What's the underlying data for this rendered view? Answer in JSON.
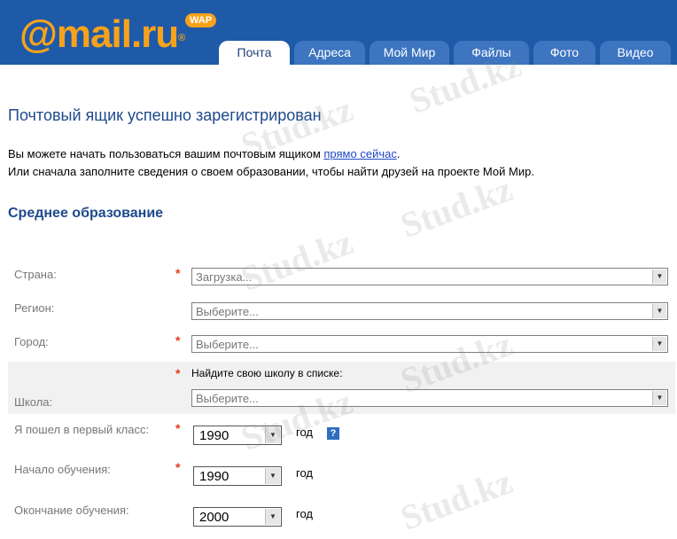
{
  "header": {
    "logo": "@mail.ru",
    "logo_mark": "®",
    "wap_badge": "WAP",
    "tabs": [
      {
        "label": "Почта"
      },
      {
        "label": "Адреса"
      },
      {
        "label": "Мой Мир"
      },
      {
        "label": "Файлы"
      },
      {
        "label": "Фото"
      },
      {
        "label": "Видео"
      }
    ]
  },
  "main": {
    "title": "Почтовый ящик успешно зарегистрирован",
    "intro_1_before": "Вы можете начать пользоваться вашим почтовым ящиком ",
    "intro_1_link": "прямо сейчас",
    "intro_1_after": ".",
    "intro_2": "Или сначала заполните сведения о своем образовании, чтобы найти друзей на проекте Мой Мир.",
    "section_title": "Среднее образование"
  },
  "form": {
    "required_mark": "*",
    "country": {
      "label": "Страна:",
      "value": "Загрузка..."
    },
    "region": {
      "label": "Регион:",
      "value": "Выберите..."
    },
    "city": {
      "label": "Город:",
      "value": "Выберите..."
    },
    "school": {
      "label": "Школа:",
      "hint": "Найдите свою школу в списке:",
      "value": "Выберите..."
    },
    "first_class": {
      "label": "Я пошел в первый класс:",
      "value": "1990",
      "unit": "год",
      "help": "?"
    },
    "start": {
      "label": "Начало обучения:",
      "value": "1990",
      "unit": "год"
    },
    "end": {
      "label": "Окончание обучения:",
      "value": "2000",
      "unit": "год"
    }
  },
  "watermark": "Stud.kz",
  "colors": {
    "header_bg": "#1f5aa8",
    "logo": "#f7a21b",
    "title": "#1e4a8c",
    "required": "#e33b1a"
  }
}
